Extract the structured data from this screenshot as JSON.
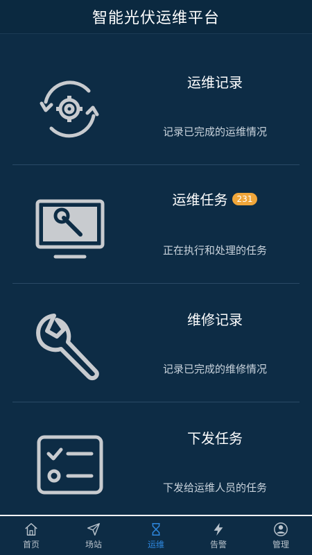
{
  "header": {
    "title": "智能光伏运维平台"
  },
  "menu": {
    "items": [
      {
        "title": "运维记录",
        "desc": "记录已完成的运维情况",
        "icon": "settings-refresh-icon"
      },
      {
        "title": "运维任务",
        "badge": "231",
        "desc": "正在执行和处理的任务",
        "icon": "monitor-wrench-icon"
      },
      {
        "title": "维修记录",
        "desc": "记录已完成的维修情况",
        "icon": "wrench-icon"
      },
      {
        "title": "下发任务",
        "desc": "下发给运维人员的任务",
        "icon": "checklist-icon"
      }
    ]
  },
  "tabbar": {
    "tabs": [
      {
        "label": "首页",
        "icon": "home-icon"
      },
      {
        "label": "场站",
        "icon": "send-icon"
      },
      {
        "label": "运维",
        "icon": "hourglass-icon",
        "active": true
      },
      {
        "label": "告警",
        "icon": "lightning-icon"
      },
      {
        "label": "管理",
        "icon": "user-icon"
      }
    ]
  },
  "colors": {
    "background": "#0d2c45",
    "accent": "#2e88e0",
    "badge": "#f0a63a"
  }
}
